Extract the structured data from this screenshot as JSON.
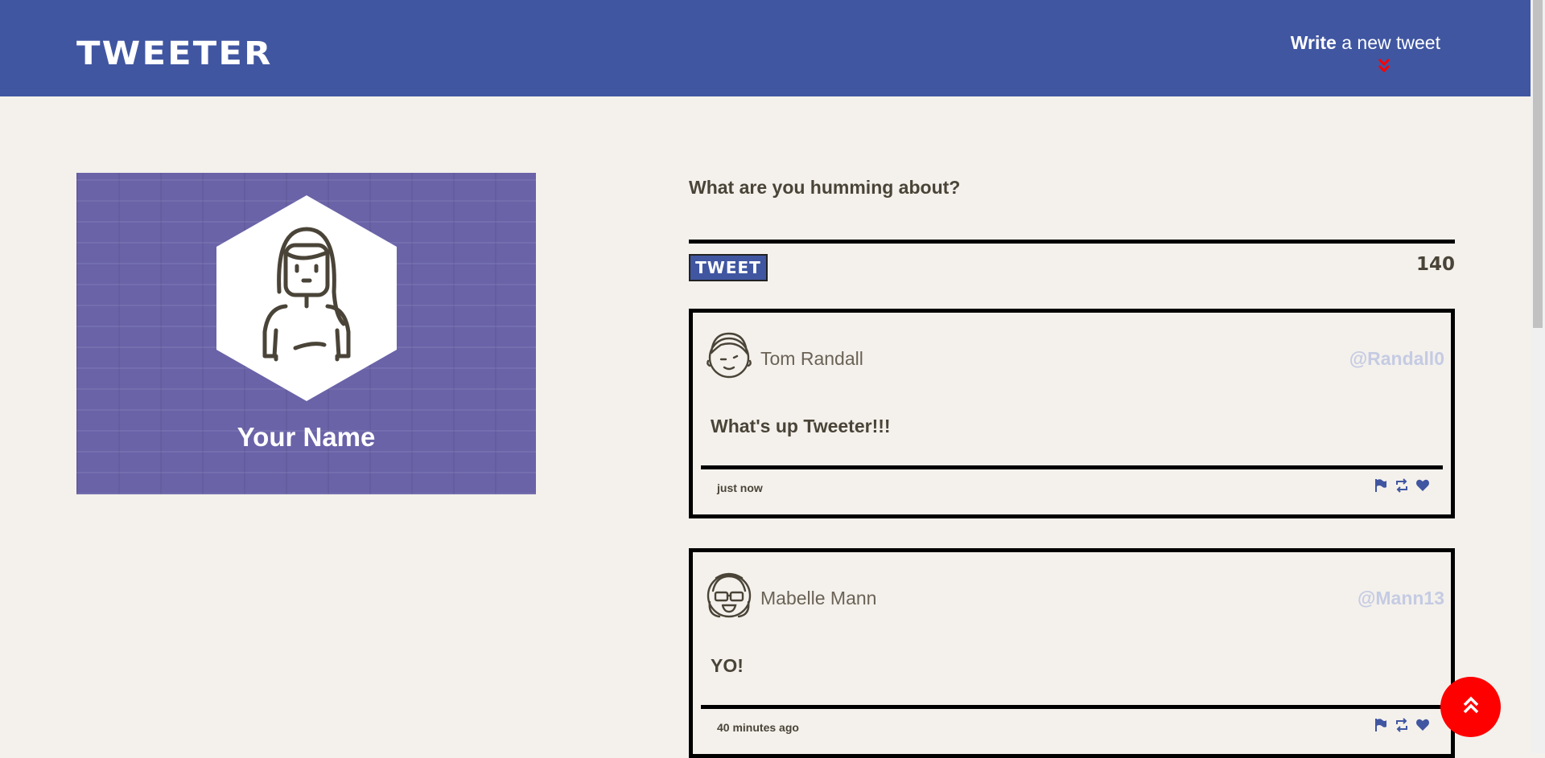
{
  "header": {
    "brand": "TWEETER",
    "compose_bold": "Write",
    "compose_rest": " a new tweet"
  },
  "profile": {
    "name": "Your Name"
  },
  "composer": {
    "prompt": "What are you humming about?",
    "button_label": "TWEET",
    "counter": "140"
  },
  "tweets": [
    {
      "name": "Tom Randall",
      "handle": "@Randall0",
      "body": "What's up Tweeter!!!",
      "time": "just now"
    },
    {
      "name": "Mabelle Mann",
      "handle": "@Mann13",
      "body": "YO!",
      "time": "40 minutes ago"
    }
  ],
  "icons": {
    "actions": [
      "flag-icon",
      "retweet-icon",
      "heart-icon"
    ],
    "scroll_top": "double-chevron-up-icon",
    "compose_arrow": "double-chevron-down-icon"
  },
  "colors": {
    "brand_blue": "#4056a1",
    "accent_red": "#ff0000",
    "background": "#f4f1ec",
    "profile_purple": "#6a63a8",
    "handle_color": "#c5cbe3"
  }
}
